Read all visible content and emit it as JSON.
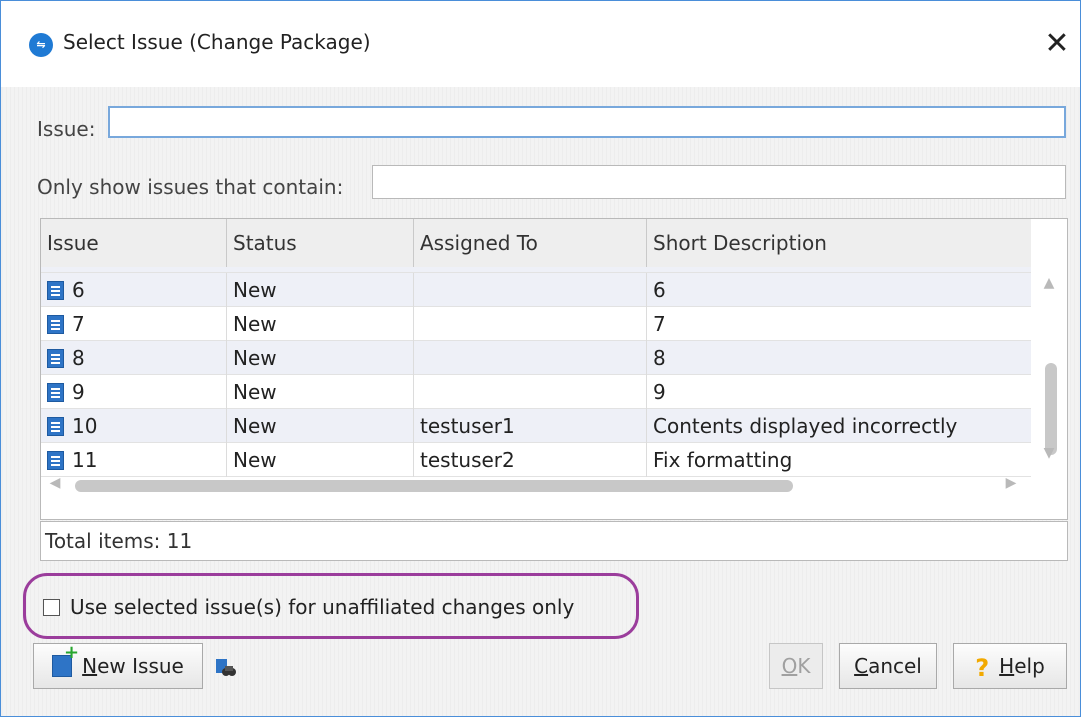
{
  "window": {
    "title": "Select Issue (Change Package)",
    "icon": "app-logo-icon",
    "close_icon": "close-icon"
  },
  "issue_field": {
    "label": "Issue:",
    "value": ""
  },
  "filter_field": {
    "label": "Only show issues that contain:",
    "value": ""
  },
  "table": {
    "columns": [
      "Issue",
      "Status",
      "Assigned To",
      "Short Description"
    ],
    "rows": [
      {
        "issue": "6",
        "status": "New",
        "assigned": "",
        "desc": "6"
      },
      {
        "issue": "7",
        "status": "New",
        "assigned": "",
        "desc": "7"
      },
      {
        "issue": "8",
        "status": "New",
        "assigned": "",
        "desc": "8"
      },
      {
        "issue": "9",
        "status": "New",
        "assigned": "",
        "desc": "9"
      },
      {
        "issue": "10",
        "status": "New",
        "assigned": "testuser1",
        "desc": "Contents displayed incorrectly"
      },
      {
        "issue": "11",
        "status": "New",
        "assigned": "testuser2",
        "desc": "Fix formatting"
      }
    ]
  },
  "total_items": "Total items: 11",
  "checkbox": {
    "label": "Use selected issue(s) for unaffiliated changes only",
    "checked": false
  },
  "buttons": {
    "new_issue_mnemonic": "N",
    "new_issue_rest": "ew Issue",
    "ok_mnemonic": "O",
    "ok_rest": "K",
    "cancel_mnemonic": "C",
    "cancel_rest": "ancel",
    "help_mnemonic": "H",
    "help_rest": "elp"
  },
  "colors": {
    "accent": "#4a8ed9",
    "highlight": "#9b3d9c",
    "issue_icon": "#2e74c6"
  }
}
